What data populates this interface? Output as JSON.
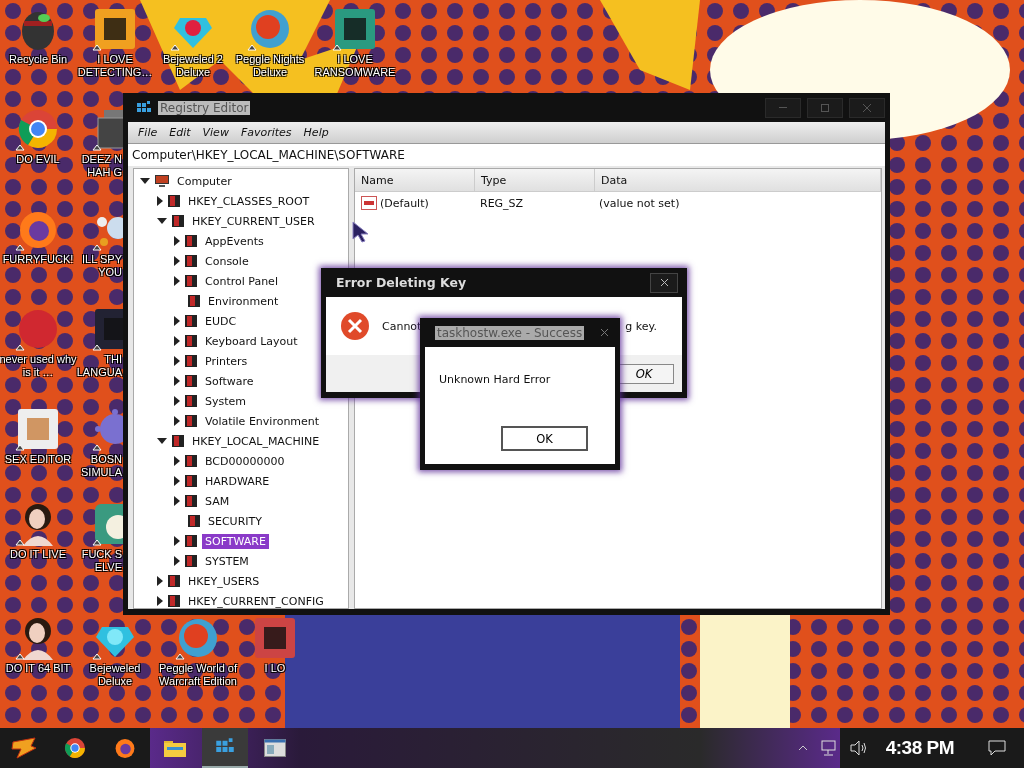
{
  "desktop_icons": [
    {
      "label": "Recycle Bin",
      "shortcut": false,
      "clipped": false
    },
    {
      "label": "I LOVE DETECTING…",
      "shortcut": true,
      "clipped": false
    },
    {
      "label": "Bejeweled 2 Deluxe",
      "shortcut": true,
      "clipped": false
    },
    {
      "label": "Peggle Nights Deluxe",
      "shortcut": true,
      "clipped": false
    },
    {
      "label": "I LOVE RANSOMWARE",
      "shortcut": true,
      "clipped": false
    },
    {
      "label": "DO EVIL",
      "shortcut": true,
      "clipped": false
    },
    {
      "label": "DEEZ N HAH G",
      "shortcut": true,
      "clipped": true
    },
    {
      "label": "FURRYFUCK!",
      "shortcut": true,
      "clipped": false
    },
    {
      "label": "ILL SPY YOU",
      "shortcut": true,
      "clipped": true
    },
    {
      "label": "never used why is it …",
      "shortcut": true,
      "clipped": false
    },
    {
      "label": "THI LANGUA",
      "shortcut": true,
      "clipped": true
    },
    {
      "label": "SEX EDITOR",
      "shortcut": true,
      "clipped": false
    },
    {
      "label": "BOSN SIMULA",
      "shortcut": true,
      "clipped": true
    },
    {
      "label": "DO IT LIVE",
      "shortcut": true,
      "clipped": false
    },
    {
      "label": "FUCK S ELVE",
      "shortcut": true,
      "clipped": true
    },
    {
      "label": "DO IT 64 BIT",
      "shortcut": true,
      "clipped": false
    },
    {
      "label": "Bejeweled Deluxe",
      "shortcut": true,
      "clipped": false
    },
    {
      "label": "Peggle World of Warcraft Edition",
      "shortcut": true,
      "clipped": false
    },
    {
      "label": "I LO",
      "shortcut": false,
      "clipped": false
    }
  ],
  "registry_editor": {
    "title": "Registry Editor",
    "menu": [
      "File",
      "Edit",
      "View",
      "Favorites",
      "Help"
    ],
    "address": "Computer\\HKEY_LOCAL_MACHINE\\SOFTWARE",
    "tree": [
      {
        "label": "Computer",
        "expandable": true,
        "expanded": true,
        "selected": false,
        "children": [
          {
            "label": "HKEY_CLASSES_ROOT",
            "expandable": true,
            "expanded": false,
            "selected": false
          },
          {
            "label": "HKEY_CURRENT_USER",
            "expandable": true,
            "expanded": true,
            "selected": false,
            "children": [
              {
                "label": "AppEvents",
                "expandable": true,
                "expanded": false,
                "selected": false
              },
              {
                "label": "Console",
                "expandable": true,
                "expanded": false,
                "selected": false
              },
              {
                "label": "Control Panel",
                "expandable": true,
                "expanded": false,
                "selected": false
              },
              {
                "label": "Environment",
                "expandable": false,
                "selected": false
              },
              {
                "label": "EUDC",
                "expandable": true,
                "expanded": false,
                "selected": false
              },
              {
                "label": "Keyboard Layout",
                "expandable": true,
                "expanded": false,
                "selected": false
              },
              {
                "label": "Printers",
                "expandable": true,
                "expanded": false,
                "selected": false
              },
              {
                "label": "Software",
                "expandable": true,
                "expanded": false,
                "selected": false
              },
              {
                "label": "System",
                "expandable": true,
                "expanded": false,
                "selected": false
              },
              {
                "label": "Volatile Environment",
                "expandable": true,
                "expanded": false,
                "selected": false
              }
            ]
          },
          {
            "label": "HKEY_LOCAL_MACHINE",
            "expandable": true,
            "expanded": true,
            "selected": false,
            "children": [
              {
                "label": "BCD00000000",
                "expandable": true,
                "expanded": false,
                "selected": false
              },
              {
                "label": "HARDWARE",
                "expandable": true,
                "expanded": false,
                "selected": false
              },
              {
                "label": "SAM",
                "expandable": true,
                "expanded": false,
                "selected": false
              },
              {
                "label": "SECURITY",
                "expandable": false,
                "selected": false
              },
              {
                "label": "SOFTWARE",
                "expandable": true,
                "expanded": false,
                "selected": true
              },
              {
                "label": "SYSTEM",
                "expandable": true,
                "expanded": false,
                "selected": false
              }
            ]
          },
          {
            "label": "HKEY_USERS",
            "expandable": true,
            "expanded": false,
            "selected": false
          },
          {
            "label": "HKEY_CURRENT_CONFIG",
            "expandable": true,
            "expanded": false,
            "selected": false
          }
        ]
      }
    ],
    "columns": [
      "Name",
      "Type",
      "Data"
    ],
    "rows": [
      {
        "name": "(Default)",
        "type": "REG_SZ",
        "data": "(value not set)"
      }
    ]
  },
  "error_dialog": {
    "title": "Error Deleting Key",
    "message_start": "Cannot",
    "message_end": "g key.",
    "button": "OK"
  },
  "hard_error_dialog": {
    "title": "taskhostw.exe - Success",
    "message": "Unknown Hard Error",
    "button": "OK"
  },
  "taskbar": {
    "apps": [
      {
        "selected": false
      },
      {
        "selected": false
      },
      {
        "selected": false
      },
      {
        "selected": true
      },
      {
        "selected": false
      }
    ],
    "clock": "4:38 PM"
  }
}
